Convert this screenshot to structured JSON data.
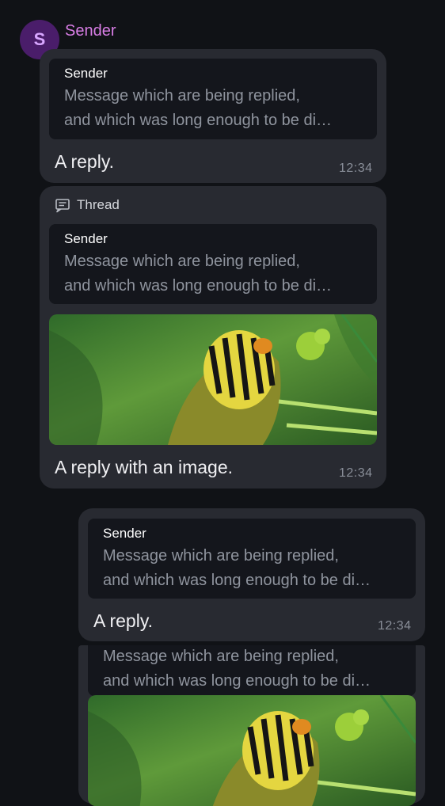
{
  "sender": {
    "avatar_letter": "S",
    "name": "Sender"
  },
  "messages": [
    {
      "quote_sender": "Sender",
      "quote_text": "Message which are being replied,\nand which was long enough to be di…",
      "text": "A reply.",
      "time": "12:34"
    },
    {
      "thread_label": "Thread",
      "quote_sender": "Sender",
      "quote_text": "Message which are being replied,\nand which was long enough to be di…",
      "text": "A reply with an image.",
      "time": "12:34"
    },
    {
      "quote_sender": "Sender",
      "quote_text": "Message which are being replied,\nand which was long enough to be di…",
      "text": "A reply.",
      "time": "12:34"
    },
    {
      "quote_text": "Message which are being replied,\nand which was long enough to be di…"
    }
  ],
  "colors": {
    "background": "#101216",
    "bubble": "#282a31",
    "quote_background": "#14161c",
    "sender_name": "#d97ee6",
    "avatar_bg": "#4a1d6a"
  },
  "icons": {
    "thread": "thread-icon"
  }
}
